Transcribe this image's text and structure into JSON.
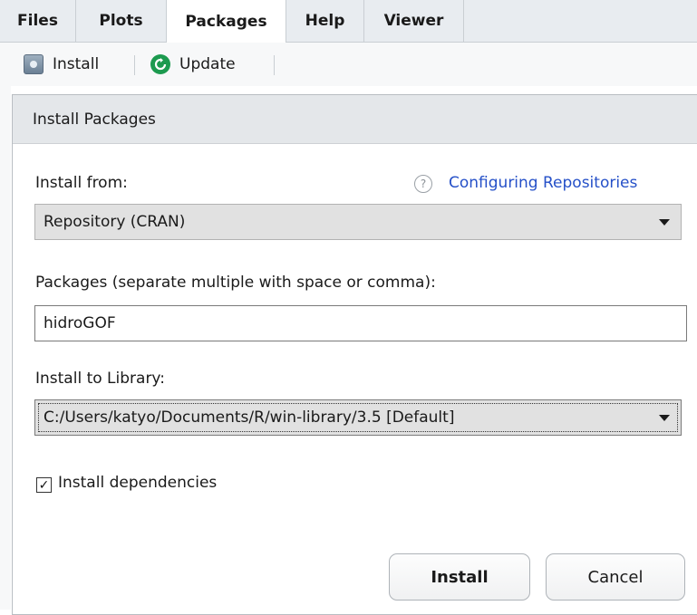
{
  "tabs": [
    {
      "label": "Files",
      "active": false
    },
    {
      "label": "Plots",
      "active": false
    },
    {
      "label": "Packages",
      "active": true
    },
    {
      "label": "Help",
      "active": false
    },
    {
      "label": "Viewer",
      "active": false
    }
  ],
  "toolbar": {
    "install_label": "Install",
    "install_icon": "package-icon",
    "update_label": "Update",
    "update_icon": "refresh-icon",
    "update_color": "#1c9a4f"
  },
  "dialog": {
    "title": "Install Packages",
    "install_from": {
      "label": "Install from:",
      "help_glyph": "?",
      "help_link": "Configuring Repositories",
      "selected": "Repository (CRAN)"
    },
    "packages": {
      "label": "Packages (separate multiple with space or comma):",
      "value": "hidroGOF"
    },
    "library": {
      "label": "Install to Library:",
      "selected": "C:/Users/katyo/Documents/R/win-library/3.5 [Default]"
    },
    "dependencies": {
      "checked": true,
      "check_glyph": "✓",
      "label": "Install dependencies"
    },
    "buttons": {
      "install": "Install",
      "cancel": "Cancel"
    }
  },
  "colors": {
    "link": "#2550c8",
    "tabbar": "#e8ecf0",
    "titlebar": "#e4e7ea"
  }
}
